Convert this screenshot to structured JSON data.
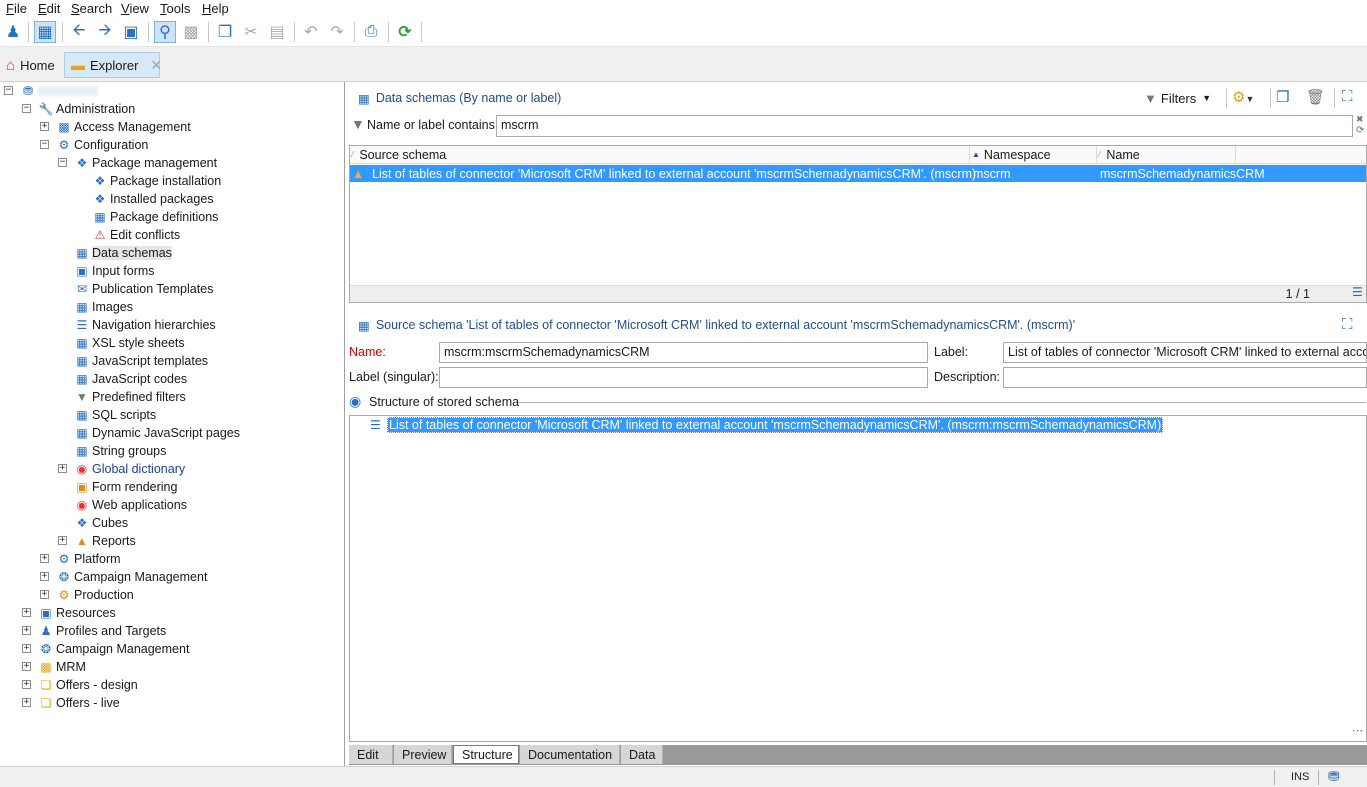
{
  "menu": [
    "File",
    "Edit",
    "Search",
    "View",
    "Tools",
    "Help"
  ],
  "tabs": {
    "home": "Home",
    "explorer": "Explorer"
  },
  "tree": {
    "root_label": "",
    "administration": "Administration",
    "access_management": "Access Management",
    "configuration": "Configuration",
    "package_management": "Package management",
    "package_installation": "Package installation",
    "installed_packages": "Installed packages",
    "package_definitions": "Package definitions",
    "edit_conflicts": "Edit conflicts",
    "data_schemas": "Data schemas",
    "input_forms": "Input forms",
    "publication_templates": "Publication Templates",
    "images": "Images",
    "navigation_hierarchies": "Navigation hierarchies",
    "xsl_style_sheets": "XSL style sheets",
    "javascript_templates": "JavaScript templates",
    "javascript_codes": "JavaScript codes",
    "predefined_filters": "Predefined filters",
    "sql_scripts": "SQL scripts",
    "dynamic_js_pages": "Dynamic JavaScript pages",
    "string_groups": "String groups",
    "global_dictionary": "Global dictionary",
    "form_rendering": "Form rendering",
    "web_applications": "Web applications",
    "cubes": "Cubes",
    "reports": "Reports",
    "platform": "Platform",
    "campaign_management_admin": "Campaign Management",
    "production": "Production",
    "resources": "Resources",
    "profiles_targets": "Profiles and Targets",
    "campaign_management": "Campaign Management",
    "mrm": "MRM",
    "offers_design": "Offers - design",
    "offers_live": "Offers - live"
  },
  "list_panel": {
    "title": "Data schemas (By name or label)",
    "filters_label": "Filters",
    "filter_label": "Name or label contains:",
    "filter_value": "mscrm",
    "columns": [
      "Source schema",
      "Namespace",
      "Name"
    ],
    "rows": [
      {
        "source_schema": "List of tables of connector 'Microsoft CRM' linked to external account 'mscrmSchemadynamicsCRM'. (mscrm)",
        "namespace": "mscrm",
        "name": "mscrmSchemadynamicsCRM"
      }
    ],
    "pager": "1 / 1"
  },
  "detail_panel": {
    "title": "Source schema 'List of tables of connector 'Microsoft CRM' linked to external account 'mscrmSchemadynamicsCRM'. (mscrm)'",
    "name_label": "Name:",
    "name_value": "mscrm:mscrmSchemadynamicsCRM",
    "label_label": "Label:",
    "label_value": "List of tables of connector 'Microsoft CRM' linked to external account 'mscrmSchemadynamicsCRM'",
    "label_singular_label": "Label (singular):",
    "label_singular_value": "",
    "description_label": "Description:",
    "description_value": "",
    "structure_title": "Structure of stored schema",
    "structure_item": "List of tables of connector 'Microsoft CRM' linked to external account 'mscrmSchemadynamicsCRM'. (mscrm:mscrmSchemadynamicsCRM)"
  },
  "bottom_tabs": [
    "Edit",
    "Preview",
    "Structure",
    "Documentation",
    "Data"
  ],
  "active_bottom_tab": "Structure",
  "status": {
    "mode": "INS"
  },
  "colors": {
    "selection": "#3399ff",
    "link_blue": "#1f4e8c",
    "required_red": "#cc0000"
  }
}
